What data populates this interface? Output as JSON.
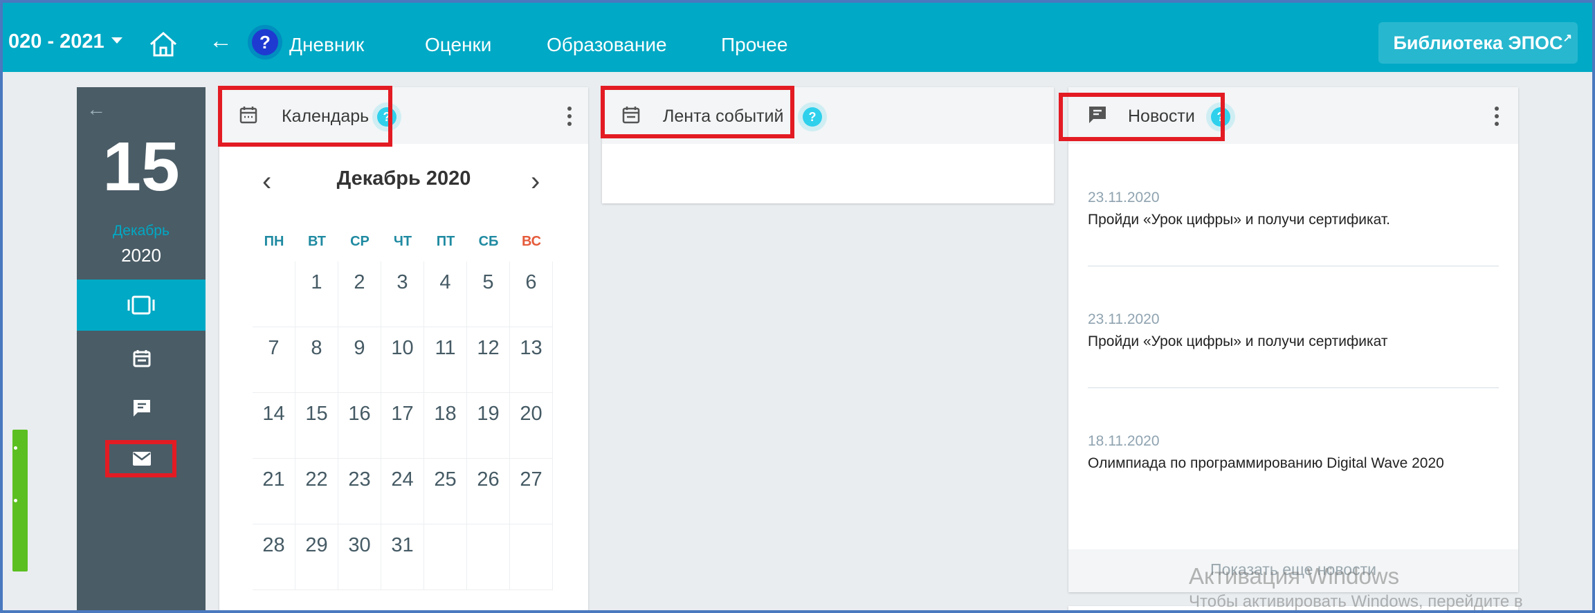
{
  "colors": {
    "topbar": "#00a9c5",
    "sidebar": "#4a5c66",
    "highlight": "#e31b23",
    "accent": "#2fd0ec"
  },
  "header": {
    "year": "020 - 2021",
    "nav": [
      "Дневник",
      "Оценки",
      "Образование",
      "Прочее"
    ],
    "library_button": "Библиотека ЭПОС"
  },
  "sidebar": {
    "day": "15",
    "month": "Декабрь",
    "year": "2020",
    "icons": [
      "card-view-icon",
      "calendar-icon",
      "feedback-icon",
      "mail-icon"
    ]
  },
  "calendar": {
    "title": "Календарь",
    "month_label": "Декабрь 2020",
    "weekdays": [
      "ПН",
      "ВТ",
      "СР",
      "ЧТ",
      "ПТ",
      "СБ",
      "ВС"
    ],
    "weeks": [
      [
        "",
        "1",
        "2",
        "3",
        "4",
        "5",
        "6"
      ],
      [
        "7",
        "8",
        "9",
        "10",
        "11",
        "12",
        "13"
      ],
      [
        "14",
        "15",
        "16",
        "17",
        "18",
        "19",
        "20"
      ],
      [
        "21",
        "22",
        "23",
        "24",
        "25",
        "26",
        "27"
      ],
      [
        "28",
        "29",
        "30",
        "31",
        "",
        "",
        ""
      ]
    ]
  },
  "events": {
    "title": "Лента событий"
  },
  "news": {
    "title": "Новости",
    "items": [
      {
        "date": "23.11.2020",
        "text": "Пройди «Урок цифры» и получи сертификат."
      },
      {
        "date": "23.11.2020",
        "text": "Пройди «Урок цифры» и получи сертификат"
      },
      {
        "date": "18.11.2020",
        "text": "Олимпиада по программированию Digital Wave 2020"
      }
    ],
    "more": "Показать еще новости"
  },
  "watermark": {
    "line1": "Активация Windows",
    "line2": "Чтобы активировать Windows, перейдите в"
  }
}
